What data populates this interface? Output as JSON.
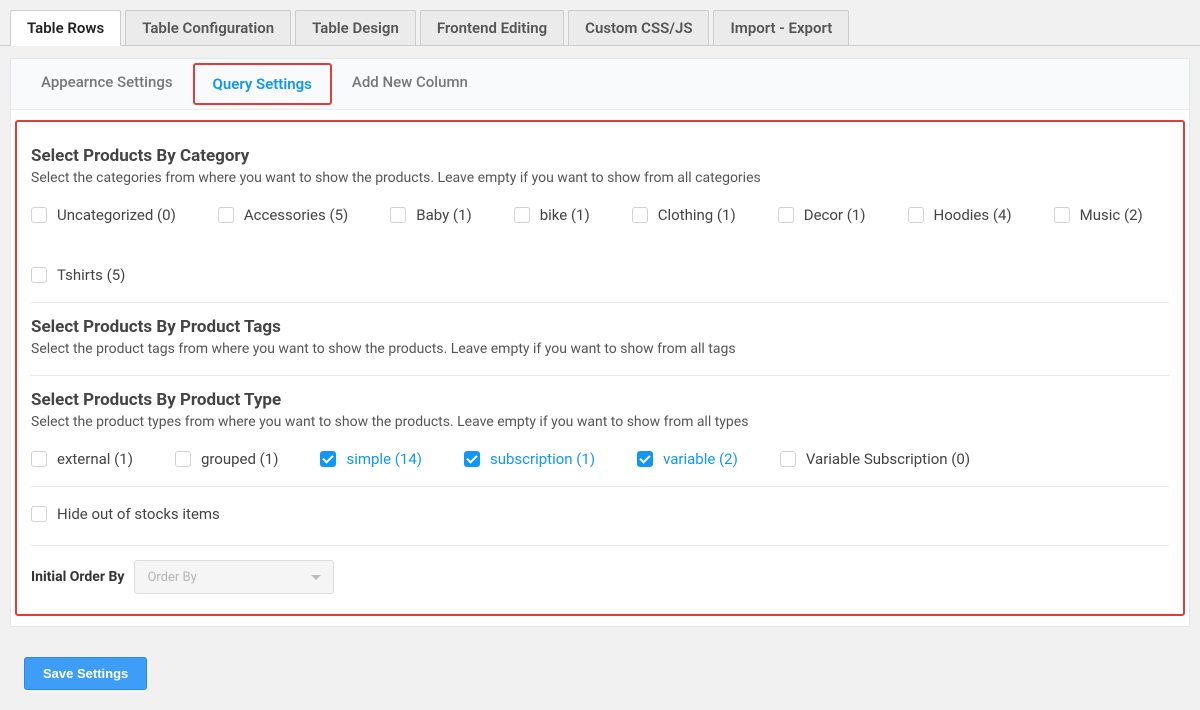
{
  "top_tabs": {
    "table_rows": "Table Rows",
    "table_configuration": "Table Configuration",
    "table_design": "Table Design",
    "frontend_editing": "Frontend Editing",
    "custom_cssjs": "Custom CSS/JS",
    "import_export": "Import - Export"
  },
  "sub_tabs": {
    "appearance": "Appearnce Settings",
    "query": "Query Settings",
    "add_column": "Add New Column"
  },
  "sections": {
    "by_category": {
      "title": "Select Products By Category",
      "desc": "Select the categories from where you want to show the products. Leave empty if you want to show from all categories",
      "items": [
        {
          "label": "Uncategorized (0)",
          "checked": false
        },
        {
          "label": "Accessories (5)",
          "checked": false
        },
        {
          "label": "Baby (1)",
          "checked": false
        },
        {
          "label": "bike (1)",
          "checked": false
        },
        {
          "label": "Clothing (1)",
          "checked": false
        },
        {
          "label": "Decor (1)",
          "checked": false
        },
        {
          "label": "Hoodies (4)",
          "checked": false
        },
        {
          "label": "Music (2)",
          "checked": false
        },
        {
          "label": "Tshirts (5)",
          "checked": false
        }
      ]
    },
    "by_tags": {
      "title": "Select Products By Product Tags",
      "desc": "Select the product tags from where you want to show the products. Leave empty if you want to show from all tags"
    },
    "by_type": {
      "title": "Select Products By Product Type",
      "desc": "Select the product types from where you want to show the products. Leave empty if you want to show from all types",
      "items": [
        {
          "label": "external (1)",
          "checked": false
        },
        {
          "label": "grouped (1)",
          "checked": false
        },
        {
          "label": "simple (14)",
          "checked": true
        },
        {
          "label": "subscription (1)",
          "checked": true
        },
        {
          "label": "variable (2)",
          "checked": true
        },
        {
          "label": "Variable Subscription (0)",
          "checked": false
        }
      ]
    },
    "hide_out": {
      "label": "Hide out of stocks items",
      "checked": false
    },
    "order_by": {
      "label": "Initial Order By",
      "placeholder": "Order By"
    }
  },
  "save_button": "Save Settings"
}
